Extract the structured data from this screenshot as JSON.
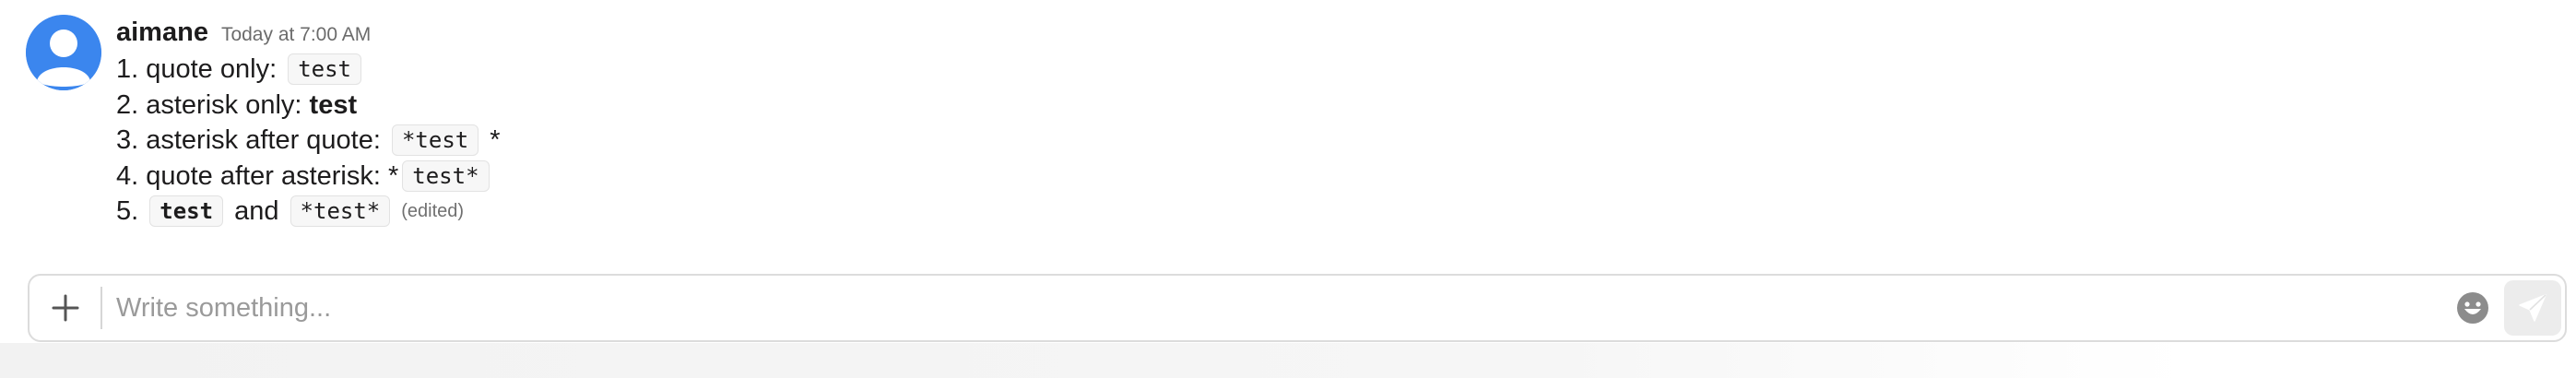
{
  "message": {
    "author": "aimane",
    "timestamp": "Today at 7:00 AM",
    "lines": {
      "l1": {
        "prefix": "1. quote only: ",
        "code": "test"
      },
      "l2": {
        "prefix": "2. asterisk only: ",
        "bold": "test"
      },
      "l3": {
        "prefix": "3. asterisk after quote: ",
        "code": "*test",
        "suffix": " *"
      },
      "l4": {
        "prefix": "4. quote after asterisk: ",
        "star": "*",
        "code": "test*"
      },
      "l5": {
        "prefix": "5. ",
        "code1": "test",
        "middle": " and ",
        "code2": "*test*",
        "edited": "(edited)"
      }
    }
  },
  "composer": {
    "placeholder": "Write something...",
    "value": "",
    "icons": {
      "add": "plus-icon",
      "emoji": "smiley-icon",
      "send": "paper-plane-icon"
    }
  },
  "colors": {
    "avatar": "#3b86ee",
    "send_button_bg": "#ececec",
    "code_bg": "#f7f7f7"
  }
}
